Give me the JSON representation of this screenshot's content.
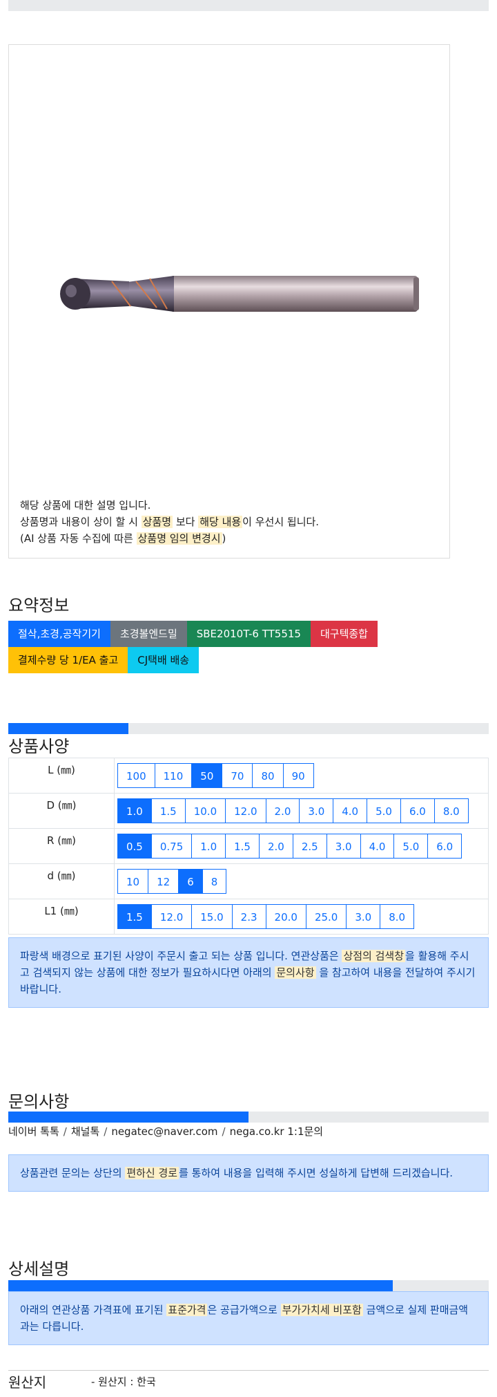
{
  "product": {
    "image_alt": "ball end mill",
    "desc_line1": "해당 상품에 대한 설명 입니다.",
    "desc_line2_a": "상품명과 내용이 상이 할 시 ",
    "desc_line2_hl1": "상품명",
    "desc_line2_b": " 보다 ",
    "desc_line2_hl2": "해당 내용",
    "desc_line2_c": "이 우선시 됩니다.",
    "desc_line3_a": "(AI 상품 자동 수집에 따른 ",
    "desc_line3_hl": "상품명 임의 변경시",
    "desc_line3_b": ")"
  },
  "summary": {
    "title": "요약정보",
    "tags": [
      {
        "label": "절삭,초경,공작기기",
        "color": "#0d6efd",
        "text_color": "#ffffff"
      },
      {
        "label": "초경볼엔드밀",
        "color": "#6c757d",
        "text_color": "#ffffff"
      },
      {
        "label": "SBE2010T-6 TT5515",
        "color": "#198754",
        "text_color": "#ffffff"
      },
      {
        "label": "대구텍종합",
        "color": "#dc3545",
        "text_color": "#ffffff"
      },
      {
        "label": "결제수량 당 1/EA 출고",
        "color": "#ffc107",
        "text_color": "#111111"
      },
      {
        "label": "CJ택배 배송",
        "color": "#0dcaf0",
        "text_color": "#111111"
      }
    ]
  },
  "spec": {
    "title": "상품사양",
    "progress": 0.25,
    "rows": [
      {
        "label": "L (㎜)",
        "options": [
          "100",
          "110",
          "50",
          "70",
          "80",
          "90"
        ],
        "selected": 2
      },
      {
        "label": "D (㎜)",
        "options": [
          "1.0",
          "1.5",
          "10.0",
          "12.0",
          "2.0",
          "3.0",
          "4.0",
          "5.0",
          "6.0",
          "8.0"
        ],
        "selected": 0
      },
      {
        "label": "R (㎜)",
        "options": [
          "0.5",
          "0.75",
          "1.0",
          "1.5",
          "2.0",
          "2.5",
          "3.0",
          "4.0",
          "5.0",
          "6.0"
        ],
        "selected": 0
      },
      {
        "label": "d (㎜)",
        "options": [
          "10",
          "12",
          "6",
          "8"
        ],
        "selected": 2
      },
      {
        "label": "L1 (㎜)",
        "options": [
          "1.5",
          "12.0",
          "15.0",
          "2.3",
          "20.0",
          "25.0",
          "3.0",
          "8.0"
        ],
        "selected": 0
      }
    ],
    "note_a": "파랑색 배경으로 표기된 사양이 주문시 출고 되는 상품 입니다. 연관상품은 ",
    "note_hl1": "상점의 검색창",
    "note_b": "을 활용해 주시고 검색되지 않는 상품에 대한 정보가 필요하시다면 아래의 ",
    "note_hl2": "문의사항",
    "note_c": " 을 참고하여 내용을 전달하여 주시기 바랍니다."
  },
  "inquiry": {
    "title": "문의사항",
    "progress": 0.5,
    "channels": [
      "네이버 톡톡",
      "채널톡",
      "negatec@naver.com",
      "nega.co.kr 1:1문의"
    ],
    "separator": "/",
    "note_a": "상품관련 문의는 상단의 ",
    "note_hl": "편하신 경로",
    "note_b": "를 통하여 내용을 입력해 주시면 성실하게 답변해 드리겠습니다."
  },
  "detail": {
    "title": "상세설명",
    "progress": 0.8,
    "note_a": "아래의 연관상품 가격표에 표기된 ",
    "note_hl1": "표준가격",
    "note_b": "은 공급가액으로 ",
    "note_hl2": "부가가치세 비포함",
    "note_c": " 금액으로 실제 판매금액과는 다릅니다."
  },
  "origin": {
    "title": "원산지",
    "value": "- 원산지 : 한국"
  }
}
